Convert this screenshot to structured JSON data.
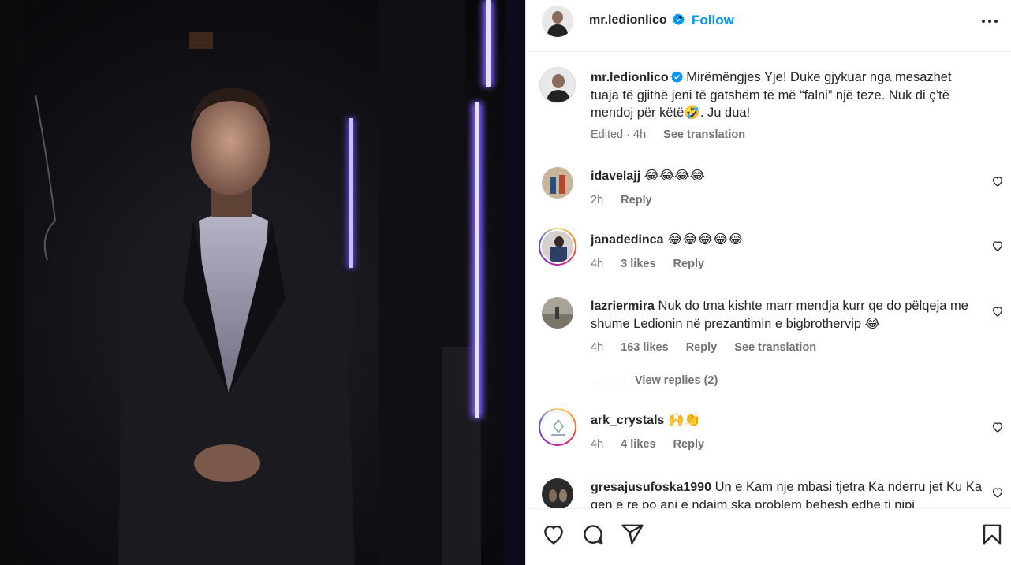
{
  "post": {
    "username": "mr.ledionlico",
    "follow_label": "Follow",
    "separator": "•"
  },
  "caption": {
    "username": "mr.ledionlico",
    "text": "Mirëmëngjes Yje! Duke gjykuar nga mesazhet tuaja të gjithë jeni të gatshëm të më “falni” një teze. Nuk di ç’të mendoj për këtë🤣. Ju dua!",
    "edited": "Edited · 4h",
    "see_translation": "See translation"
  },
  "comments": [
    {
      "username": "idavelajj",
      "text": "😂😂😂😂",
      "time": "2h",
      "likes": "",
      "reply": "Reply",
      "translate": ""
    },
    {
      "username": "janadedinca",
      "text": "😂😂😂😂😂",
      "time": "4h",
      "likes": "3 likes",
      "reply": "Reply",
      "translate": ""
    },
    {
      "username": "lazriermira",
      "text": "Nuk do tma kishte marr mendja kurr qe do pëlqeja me shume Ledionin në prezantimin e bigbrothervip 😂",
      "time": "4h",
      "likes": "163 likes",
      "reply": "Reply",
      "translate": "See translation"
    },
    {
      "username": "ark_crystals",
      "text": "🙌👏",
      "time": "4h",
      "likes": "4 likes",
      "reply": "Reply",
      "translate": ""
    },
    {
      "username": "gresajusufoska1990",
      "text": "Un e Kam nje mbasi tjetra Ka nderru jet Ku Ka gen e re po ani e ndajm ska problem behesh edhe ti nipi",
      "time": "",
      "likes": "",
      "reply": "",
      "translate": ""
    }
  ],
  "view_replies": "View replies (2)",
  "icons": {
    "more": "more-options-icon",
    "verified": "verified-badge-icon",
    "like": "heart-icon",
    "comment": "comment-icon",
    "share": "share-icon",
    "save": "bookmark-icon"
  },
  "colors": {
    "accent": "#0095f6",
    "verified": "#0095f6",
    "muted": "#737373"
  }
}
